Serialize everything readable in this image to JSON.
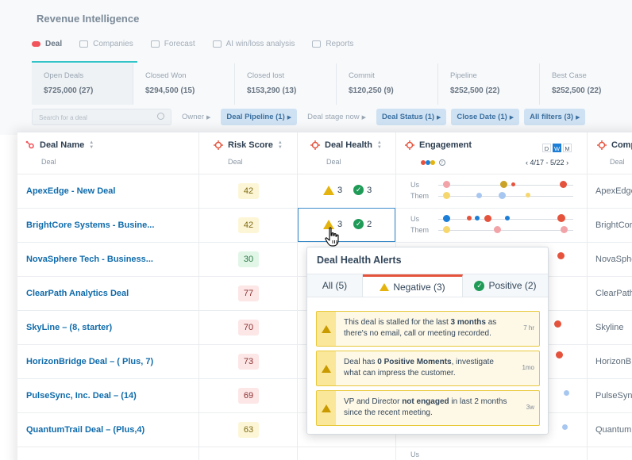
{
  "app": {
    "title": "Revenue Intelligence"
  },
  "nav_tabs": [
    {
      "label": "Deal",
      "icon": "deal-icon"
    },
    {
      "label": "Companies",
      "icon": "building-icon"
    },
    {
      "label": "Forecast",
      "icon": "forecast-icon"
    },
    {
      "label": "AI win/loss analysis",
      "icon": "ai-icon"
    },
    {
      "label": "Reports",
      "icon": "reports-icon"
    }
  ],
  "metrics": [
    {
      "label": "Open Deals",
      "value": "$725,000 (27)"
    },
    {
      "label": "Closed Won",
      "value": "$294,500 (15)"
    },
    {
      "label": "Closed lost",
      "value": "$153,290 (13)"
    },
    {
      "label": "Commit",
      "value": "$120,250 (9)"
    },
    {
      "label": "Pipeline",
      "value": "$252,500 (22)"
    },
    {
      "label": "Best Case",
      "value": "$252,500 (22)"
    }
  ],
  "filters": {
    "search_placeholder": "Search for a deal",
    "chips": [
      {
        "label": "Owner",
        "selected": false
      },
      {
        "label": "Deal Pipeline (1)",
        "selected": true
      },
      {
        "label": "Deal stage now",
        "selected": false
      },
      {
        "label": "Deal Status (1)",
        "selected": true
      },
      {
        "label": "Close Date (1)",
        "selected": true
      },
      {
        "label": "All filters (3)",
        "selected": true
      }
    ]
  },
  "table": {
    "columns": {
      "deal_name": {
        "label": "Deal Name",
        "sub": "Deal"
      },
      "risk_score": {
        "label": "Risk Score",
        "sub": "Deal"
      },
      "deal_health": {
        "label": "Deal Health",
        "sub": "Deal"
      },
      "engagement": {
        "label": "Engagement",
        "date_range": "4/17 - 5/22",
        "period_options": [
          "D",
          "W",
          "M"
        ],
        "selected_period": "W"
      },
      "company": {
        "label": "Comp",
        "sub": "Deal"
      }
    },
    "engagement_labels": {
      "us": "Us",
      "them": "Them"
    },
    "rows": [
      {
        "name": "ApexEdge - New Deal",
        "risk": "42",
        "risk_level": "yellow",
        "warnings": "3",
        "positives": "3",
        "company": "ApexEdge"
      },
      {
        "name": "BrightCore Systems - Busine...",
        "risk": "42",
        "risk_level": "yellow",
        "warnings": "3",
        "positives": "2",
        "company": "BrightCore"
      },
      {
        "name": "NovaSphere Tech - Business...",
        "risk": "30",
        "risk_level": "green",
        "company": "NovaSphere"
      },
      {
        "name": "ClearPath Analytics Deal",
        "risk": "77",
        "risk_level": "red",
        "company": "ClearPath"
      },
      {
        "name": "SkyLine – (8, starter)",
        "risk": "70",
        "risk_level": "red",
        "company": "Skyline"
      },
      {
        "name": "HorizonBridge Deal – ( Plus, 7)",
        "risk": "73",
        "risk_level": "red",
        "company": "HorizonBri"
      },
      {
        "name": "PulseSync, Inc. Deal – (14)",
        "risk": "69",
        "risk_level": "red",
        "company": "PulseSync"
      },
      {
        "name": "QuantumTrail Deal – (Plus,4)",
        "risk": "63",
        "risk_level": "yellow",
        "company": "Quantum"
      }
    ]
  },
  "popover": {
    "title": "Deal Health Alerts",
    "tabs": [
      {
        "label": "All (5)"
      },
      {
        "label": "Negative (3)"
      },
      {
        "label": "Positive (2)"
      }
    ],
    "alerts": [
      {
        "pre": "This deal is stalled for the last ",
        "bold": "3 months",
        "post": " as there's no email, call or meeting recorded.",
        "time": "7 hr"
      },
      {
        "pre": "Deal has ",
        "bold": "0 Positive Moments",
        "post": ", investigate what can impress the customer.",
        "time": "1mo"
      },
      {
        "pre": "VP and Director ",
        "bold": "not engaged",
        "post": " in last 2 months since the recent meeting.",
        "time": "3w"
      }
    ]
  },
  "colors": {
    "accent": "#0f6bab",
    "warning": "#e5b30e",
    "positive": "#1f9b57",
    "negative_tab": "#e5533d",
    "teal": "#34c4c8"
  }
}
